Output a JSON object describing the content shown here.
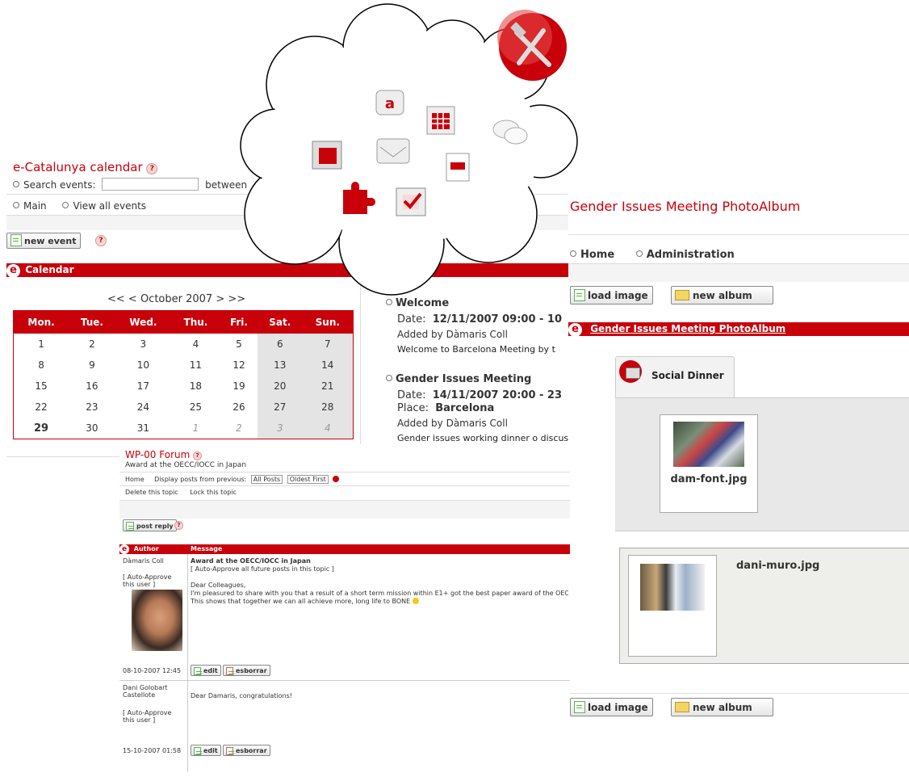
{
  "calendar": {
    "title": "e-Catalunya calendar",
    "search_label": "Search events:",
    "between_label": "between",
    "nav": [
      "Main",
      "View all events"
    ],
    "new_event": "new event",
    "bar_title": "Calendar",
    "month_nav": "<<  <  October 2007  >  >>",
    "days": [
      "Mon.",
      "Tue.",
      "Wed.",
      "Thu.",
      "Fri.",
      "Sat.",
      "Sun."
    ],
    "weeks": [
      [
        "1",
        "2",
        "3",
        "4",
        "5",
        "6",
        "7"
      ],
      [
        "8",
        "9",
        "10",
        "11",
        "12",
        "13",
        "14"
      ],
      [
        "15",
        "16",
        "17",
        "18",
        "19",
        "20",
        "21"
      ],
      [
        "22",
        "23",
        "24",
        "25",
        "26",
        "27",
        "28"
      ],
      [
        "29",
        "30",
        "31",
        "1",
        "2",
        "3",
        "4"
      ]
    ],
    "events": [
      {
        "title": "Welcome",
        "date_label": "Date:",
        "date": "12/11/2007  09:00 - 10",
        "added": "Added by Dàmaris Coll",
        "desc": "Welcome to Barcelona Meeting by t"
      },
      {
        "title": "Gender Issues Meeting",
        "date_label": "Date:",
        "date": "14/11/2007  20:00 - 23",
        "place_label": "Place:",
        "place": "Barcelona",
        "added": "Added by Dàmaris Coll",
        "desc": "Gender issues working dinner o discuss"
      }
    ]
  },
  "album": {
    "title": "Gender Issues Meeting PhotoAlbum",
    "nav": [
      "Home",
      "Administration"
    ],
    "load_image": "load image",
    "new_album": "new album",
    "bar_title": "Gender Issues Meeting PhotoAlbum",
    "tab": "Social Dinner",
    "photos": [
      "dam-font.jpg",
      "dani-muro.jpg"
    ]
  },
  "forum": {
    "title": "WP-00 Forum",
    "subtitle": "Award at the OECC/IOCC in Japan",
    "nav1": [
      "Home",
      "Display posts from previous:"
    ],
    "filter1": "All Posts",
    "filter2": "Oldest First",
    "nav2": [
      "Delete this topic",
      "Lock this topic"
    ],
    "post_reply": "post reply",
    "col_author": "Author",
    "col_message": "Message",
    "posts": [
      {
        "author": "Dàmaris Coll",
        "role": "[ Auto-Approve this user ]",
        "time": "08-10-2007 12:45",
        "subject": "Award at the OECC/IOCC in Japan",
        "approve": "[ Auto-Approve all future posts in this topic ]",
        "greeting": "Dear Colleagues,",
        "line1": "I'm pleasured to share with you that a result of a short term mission within E1+ got the best paper award of the OEC",
        "line2": "This shows that together we can all achieve more, long life to BONE"
      },
      {
        "author": "Dani Golobart Castellote",
        "role": "[ Auto-Approve this user ]",
        "time": "15-10-2007 01:58",
        "greeting": "Dear Damaris, congratulations!"
      }
    ],
    "edit": "edit",
    "delete": "esborrar"
  },
  "colors": {
    "brand_red": "#c8000a",
    "weekend_gray": "#e4e4e4"
  },
  "cloud_icons": [
    "tools-icon",
    "chat-a-icon",
    "calendar-grid-icon",
    "speech-bubbles-icon",
    "window-icon",
    "mail-icon",
    "document-icon",
    "puzzle-icon",
    "checkbox-icon"
  ]
}
